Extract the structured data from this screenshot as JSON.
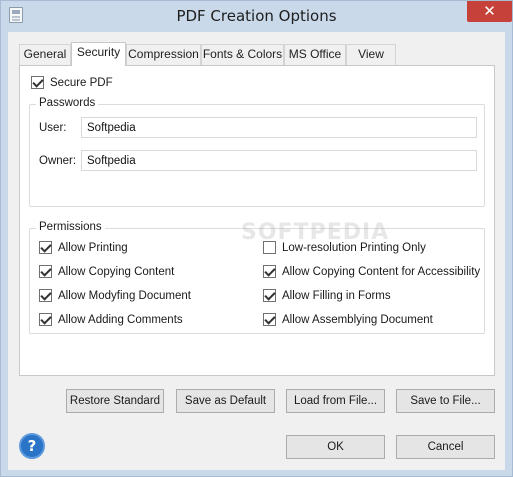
{
  "window": {
    "title": "PDF Creation Options",
    "close_glyph": "✕",
    "app_icon": "document-icon",
    "close_icon": "close-icon",
    "title_bar_color": "#c9d9ea",
    "close_color": "#c7413b"
  },
  "tabs": [
    {
      "label": "General"
    },
    {
      "label": "Security",
      "active": true
    },
    {
      "label": "Compression"
    },
    {
      "label": "Fonts & Colors"
    },
    {
      "label": "MS Office"
    },
    {
      "label": "View"
    }
  ],
  "security": {
    "secure_pdf": {
      "label": "Secure PDF",
      "checked": true
    },
    "passwords": {
      "title": "Passwords",
      "user_label": "User:",
      "user_value": "Softpedia",
      "owner_label": "Owner:",
      "owner_value": "Softpedia"
    },
    "permissions": {
      "title": "Permissions",
      "left": [
        {
          "label": "Allow Printing",
          "checked": true
        },
        {
          "label": "Allow Copying Content",
          "checked": true
        },
        {
          "label": "Allow Modyfing Document",
          "checked": true
        },
        {
          "label": "Allow Adding Comments",
          "checked": true
        }
      ],
      "right": [
        {
          "label": "Low-resolution Printing Only",
          "checked": false
        },
        {
          "label": "Allow Copying Content for Accessibility",
          "checked": true
        },
        {
          "label": "Allow Filling in Forms",
          "checked": true
        },
        {
          "label": "Allow Assemblying Document",
          "checked": true
        }
      ]
    }
  },
  "actions": {
    "restore": "Restore Standard",
    "save_default": "Save as Default",
    "load": "Load from File...",
    "save_file": "Save to File..."
  },
  "footer": {
    "help_glyph": "?",
    "help_icon": "help-icon",
    "ok": "OK",
    "cancel": "Cancel"
  },
  "watermark": "SOFTPEDIA"
}
